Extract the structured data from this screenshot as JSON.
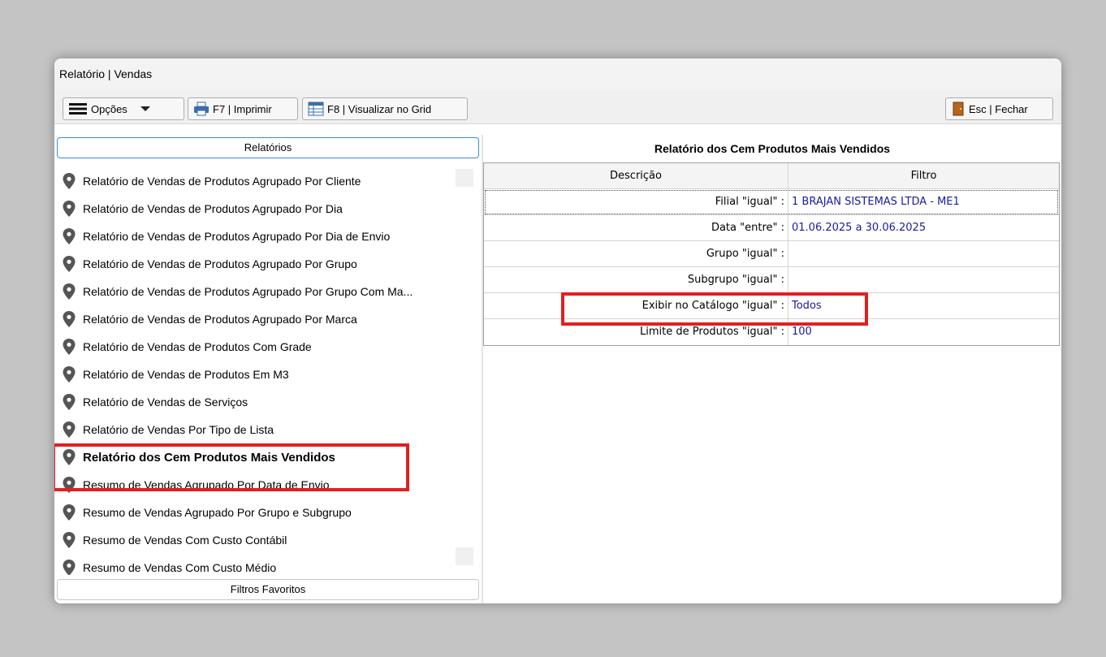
{
  "window": {
    "title": "Relatório | Vendas"
  },
  "toolbar": {
    "options_label": "Opções",
    "print_label": "F7 | Imprimir",
    "grid_label": "F8 | Visualizar no Grid",
    "close_label": "Esc | Fechar"
  },
  "left_panel": {
    "reports_header": "Relatórios",
    "favorites_header": "Filtros Favoritos",
    "items": [
      {
        "label": "Relatório de Vendas de Produtos Agrupado Por Cliente"
      },
      {
        "label": "Relatório de Vendas de Produtos Agrupado Por Dia"
      },
      {
        "label": "Relatório de Vendas de Produtos Agrupado Por Dia de Envio"
      },
      {
        "label": "Relatório de Vendas de Produtos Agrupado Por Grupo"
      },
      {
        "label": "Relatório de Vendas de Produtos Agrupado Por Grupo Com Ma..."
      },
      {
        "label": "Relatório de Vendas de Produtos Agrupado Por Marca"
      },
      {
        "label": "Relatório de Vendas de Produtos Com Grade"
      },
      {
        "label": "Relatório de Vendas de Produtos Em M3"
      },
      {
        "label": "Relatório de Vendas de Serviços"
      },
      {
        "label": "Relatório de Vendas Por Tipo de Lista"
      },
      {
        "label": "Relatório dos Cem Produtos Mais Vendidos",
        "selected": true
      },
      {
        "label": "Resumo de Vendas Agrupado Por Data de Envio"
      },
      {
        "label": "Resumo de Vendas Agrupado Por Grupo e Subgrupo"
      },
      {
        "label": "Resumo de Vendas Com Custo Contábil"
      },
      {
        "label": "Resumo de Vendas Com Custo Médio"
      }
    ]
  },
  "right_panel": {
    "title": "Relatório dos Cem Produtos Mais Vendidos",
    "columns": [
      "Descrição",
      "Filtro"
    ],
    "rows": [
      {
        "desc": "Filial \"igual\" :",
        "value": "1 BRAJAN SISTEMAS LTDA - ME1"
      },
      {
        "desc": "Data \"entre\" :",
        "value": "01.06.2025 a 30.06.2025"
      },
      {
        "desc": "Grupo \"igual\" :",
        "value": ""
      },
      {
        "desc": "Subgrupo \"igual\" :",
        "value": ""
      },
      {
        "desc": "Exibir no Catálogo \"igual\" :",
        "value": "Todos"
      },
      {
        "desc": "Limite de Produtos \"igual\" :",
        "value": "100"
      }
    ]
  },
  "colors": {
    "highlight": "#e02020",
    "value_text": "#1a1aa0",
    "active_header_border": "#3c8ed6"
  }
}
